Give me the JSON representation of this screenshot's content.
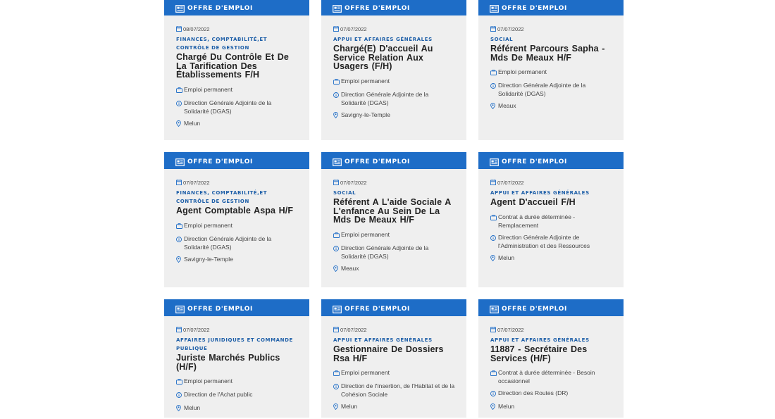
{
  "header_label": "OFFRE D'EMPLOI",
  "offers": [
    {
      "date": "08/07/2022",
      "category": "FINANCES, COMPTABILITÉ,ET CONTRÔLE DE GESTION",
      "title": "Chargé Du Contrôle Et De La Tarification Des Établissements F/H",
      "contract": "Emploi permanent",
      "direction": "Direction Générale Adjointe de la Solidarité (DGAS)",
      "location": "Melun"
    },
    {
      "date": "07/07/2022",
      "category": "APPUI ET AFFAIRES GÉNÉRALES",
      "title": "Chargé(E) D'accueil Au Service Relation Aux Usagers (F/H)",
      "contract": "Emploi permanent",
      "direction": "Direction Générale Adjointe de la Solidarité (DGAS)",
      "location": "Savigny-le-Temple"
    },
    {
      "date": "07/07/2022",
      "category": "SOCIAL",
      "title": "Référent Parcours Sapha - Mds De Meaux H/F",
      "contract": "Emploi permanent",
      "direction": "Direction Générale Adjointe de la Solidarité (DGAS)",
      "location": "Meaux"
    },
    {
      "date": "07/07/2022",
      "category": "FINANCES, COMPTABILITÉ,ET CONTRÔLE DE GESTION",
      "title": "Agent Comptable Aspa H/F",
      "contract": "Emploi permanent",
      "direction": "Direction Générale Adjointe de la Solidarité (DGAS)",
      "location": "Savigny-le-Temple"
    },
    {
      "date": "07/07/2022",
      "category": "SOCIAL",
      "title": "Référent A L'aide Sociale A L'enfance Au Sein De La Mds De Meaux H/F",
      "contract": "Emploi permanent",
      "direction": "Direction Générale Adjointe de la Solidarité (DGAS)",
      "location": "Meaux"
    },
    {
      "date": "07/07/2022",
      "category": "APPUI ET AFFAIRES GÉNÉRALES",
      "title": "Agent D'accueil F/H",
      "contract": "Contrat à durée déterminée - Remplacement",
      "direction": "Direction Générale Adjointe de l'Administration et des Ressources",
      "location": "Melun"
    },
    {
      "date": "07/07/2022",
      "category": "AFFAIRES JURIDIQUES ET COMMANDE PUBLIQUE",
      "title": "Juriste Marchés Publics (H/F)",
      "contract": "Emploi permanent",
      "direction": "Direction de l'Achat public",
      "location": "Melun"
    },
    {
      "date": "07/07/2022",
      "category": "APPUI ET AFFAIRES GÉNÉRALES",
      "title": "Gestionnaire De Dossiers Rsa H/F",
      "contract": "Emploi permanent",
      "direction": "Direction de l'Insertion, de l'Habitat et de la Cohésion Sociale",
      "location": "Melun"
    },
    {
      "date": "07/07/2022",
      "category": "APPUI ET AFFAIRES GÉNÉRALES",
      "title": "11887 - Secrétaire Des Services (H/F)",
      "contract": "Contrat à durée déterminée - Besoin occasionnel",
      "direction": "Direction des Routes (DR)",
      "location": "Melun"
    }
  ],
  "colors": {
    "header_bg": "#1e6dc7",
    "card_bg": "#efefef",
    "category": "#1e5fa8"
  },
  "icons": {
    "header": "newspaper-icon",
    "date": "calendar-icon",
    "contract": "briefcase-icon",
    "direction": "info-icon",
    "location": "map-pin-icon"
  }
}
